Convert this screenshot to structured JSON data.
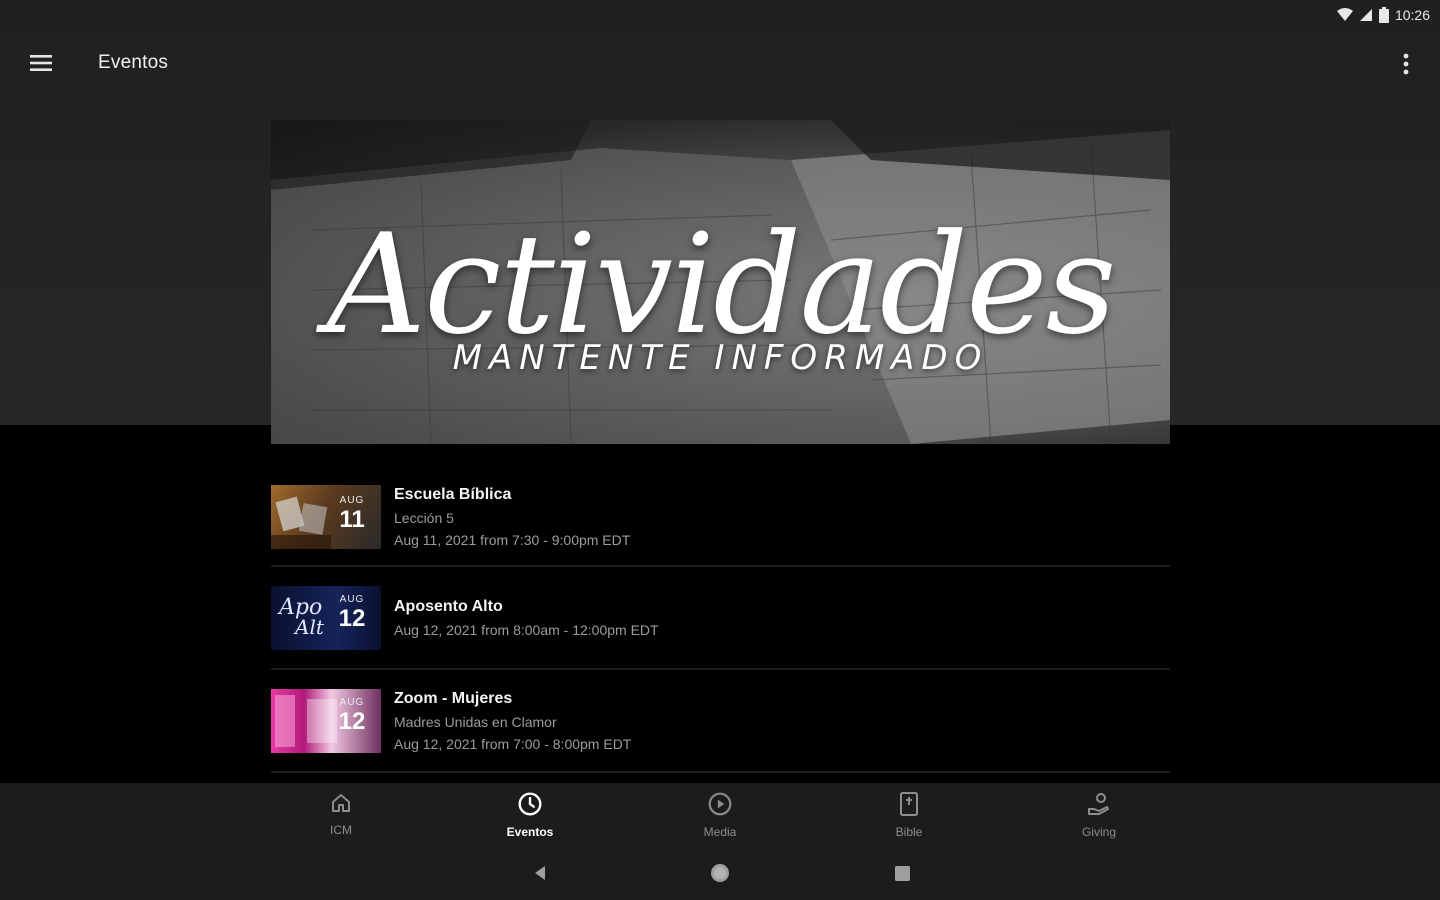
{
  "status_bar": {
    "time": "10:26",
    "icons": [
      "wifi-icon",
      "signal-icon",
      "battery-icon"
    ]
  },
  "app_bar": {
    "title": "Eventos",
    "menu_icon": "hamburger-menu-icon",
    "overflow_icon": "more-vert-icon"
  },
  "banner": {
    "title": "Actividades",
    "subtitle": "MANTENTE INFORMADO"
  },
  "events": [
    {
      "title": "Escuela Bíblica",
      "subtitle": "Lección 5",
      "time": "Aug 11, 2021 from 7:30 - 9:00pm EDT",
      "thumb_month": "AUG",
      "thumb_day": "11",
      "thumb_color": "#8a5a2b"
    },
    {
      "title": "Aposento Alto",
      "subtitle": "",
      "time": "Aug 12, 2021 from 8:00am - 12:00pm EDT",
      "thumb_month": "AUG",
      "thumb_day": "12",
      "thumb_color": "#0e1a3d"
    },
    {
      "title": "Zoom - Mujeres",
      "subtitle": "Madres Unidas en Clamor",
      "time": "Aug 12, 2021 from 7:00 - 8:00pm EDT",
      "thumb_month": "AUG",
      "thumb_day": "12",
      "thumb_color": "#c2187a"
    }
  ],
  "bottom_nav": {
    "items": [
      {
        "label": "ICM",
        "icon": "home-icon",
        "active": false
      },
      {
        "label": "Eventos",
        "icon": "clock-icon",
        "active": true
      },
      {
        "label": "Media",
        "icon": "play-circle-icon",
        "active": false
      },
      {
        "label": "Bible",
        "icon": "bible-icon",
        "active": false
      },
      {
        "label": "Giving",
        "icon": "giving-hand-icon",
        "active": false
      }
    ]
  },
  "system_nav": {
    "icons": [
      "back-icon",
      "home-circle-icon",
      "recents-icon"
    ]
  },
  "colors": {
    "top_background": "#232426",
    "list_background": "#000000",
    "nav_background": "#1b1c1e",
    "active_nav": "#ffffff",
    "inactive_nav": "#8d8d8d"
  }
}
